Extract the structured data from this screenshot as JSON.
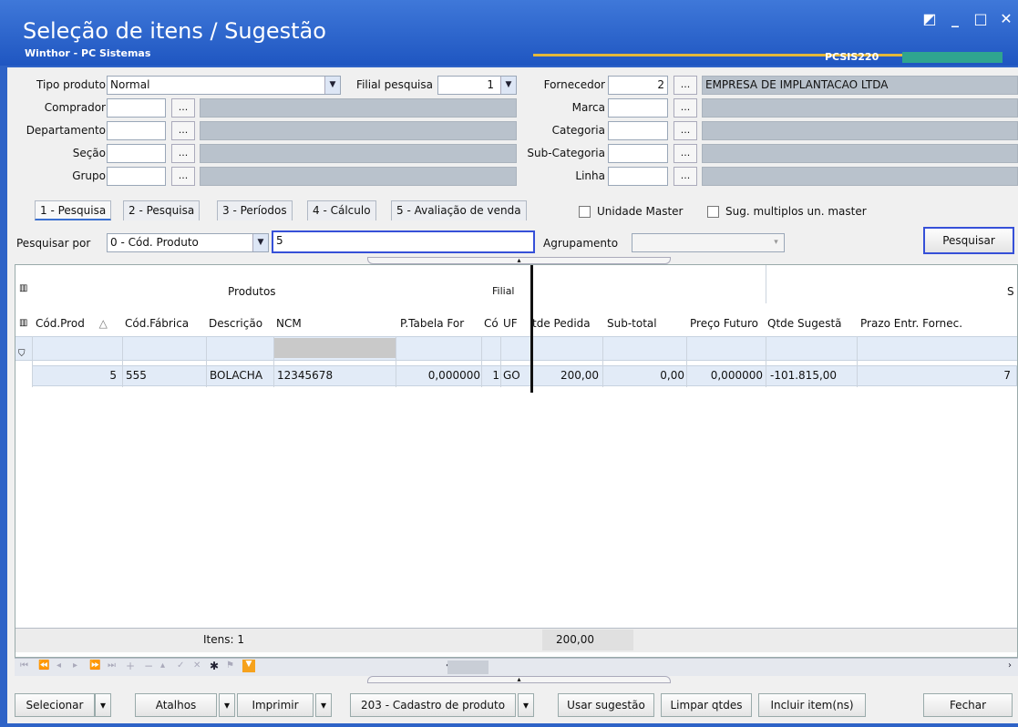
{
  "window": {
    "title": "Seleção de itens / Sugestão",
    "subtitle": "Winthor - PC Sistemas",
    "program_code": "PCSIS220",
    "controls": [
      "restore",
      "minimize",
      "maximize",
      "close"
    ]
  },
  "filters": {
    "tipo_produto_label": "Tipo produto",
    "tipo_produto_value": "Normal",
    "filial_label": "Filial pesquisa",
    "filial_value": "1",
    "fornecedor_label": "Fornecedor",
    "fornecedor_code": "2",
    "fornecedor_name": "EMPRESA DE IMPLANTACAO LTDA",
    "comprador_label": "Comprador",
    "departamento_label": "Departamento",
    "secao_label": "Seção",
    "grupo_label": "Grupo",
    "marca_label": "Marca",
    "categoria_label": "Categoria",
    "subcategoria_label": "Sub-Categoria",
    "linha_label": "Linha",
    "lookup_label": "..."
  },
  "tabs": [
    {
      "label": "1 - Pesquisa",
      "active": true
    },
    {
      "label": "2 - Pesquisa",
      "active": false
    },
    {
      "label": "3 - Períodos",
      "active": false
    },
    {
      "label": "4 - Cálculo",
      "active": false
    },
    {
      "label": "5 - Avaliação de venda",
      "active": false
    }
  ],
  "options": {
    "unidade_master_label": "Unidade Master",
    "sug_multiplos_label": "Sug. multiplos un. master"
  },
  "search": {
    "pesquisar_por_label": "Pesquisar por",
    "pesquisar_por_value": "0 - Cód. Produto",
    "search_value": "5",
    "agrupamento_label": "Agrupamento",
    "agrupamento_value": "",
    "search_button": "Pesquisar"
  },
  "grid": {
    "band_produtos": "Produtos",
    "band_filial": "Filial",
    "band_s": "S",
    "columns": [
      "Cód.Prod",
      "Cód.Fábrica",
      "Descrição",
      "NCM",
      "P.Tabela For",
      "Có",
      "UF",
      "tde Pedida",
      "Sub-total",
      "Preço Futuro",
      "Qtde Sugestã",
      "Prazo Entr. Fornec."
    ],
    "rows": [
      [
        "5",
        "555",
        "BOLACHA",
        "12345678",
        "0,000000",
        "1",
        "GO",
        "200,00",
        "0,00",
        "0,000000",
        "-101.815,00",
        "7"
      ]
    ],
    "footer_items": "Itens: 1",
    "footer_total": "200,00"
  },
  "bottom_buttons": {
    "selecionar": "Selecionar",
    "atalhos": "Atalhos",
    "imprimir": "Imprimir",
    "cadastro": "203 - Cadastro de produto",
    "usar_sugestao": "Usar sugestão",
    "limpar_qtdes": "Limpar qtdes",
    "incluir_itens": "Incluir item(ns)",
    "fechar": "Fechar"
  }
}
